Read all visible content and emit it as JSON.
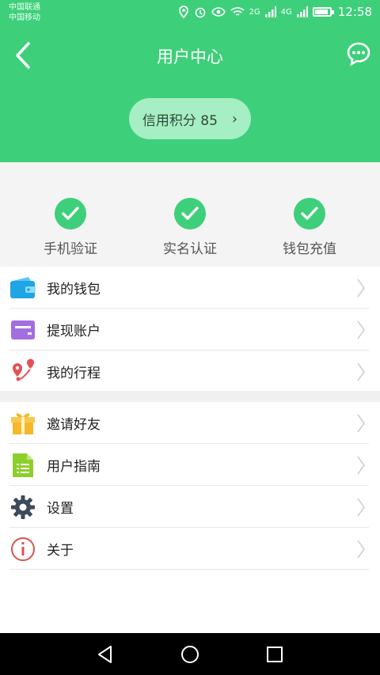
{
  "status_bar": {
    "carrier1": "中国联通",
    "carrier2": "中国移动",
    "net1": "2G",
    "net2": "4G",
    "time": "12:58",
    "battery_level_percent": 80
  },
  "header": {
    "title": "用户中心",
    "back_icon": "chevron-left-icon",
    "message_icon": "chat-bubble-icon"
  },
  "credit": {
    "label": "信用积分 85",
    "chevron": "›"
  },
  "verifications": [
    {
      "label": "手机验证",
      "status": "done"
    },
    {
      "label": "实名认证",
      "status": "done"
    },
    {
      "label": "钱包充值",
      "status": "done"
    }
  ],
  "menu_group1": [
    {
      "label": "我的钱包",
      "icon": "wallet-icon"
    },
    {
      "label": "提现账户",
      "icon": "card-icon"
    },
    {
      "label": "我的行程",
      "icon": "route-icon"
    }
  ],
  "menu_group2": [
    {
      "label": "邀请好友",
      "icon": "gift-icon"
    },
    {
      "label": "用户指南",
      "icon": "document-icon"
    },
    {
      "label": "设置",
      "icon": "gear-icon"
    },
    {
      "label": "关于",
      "icon": "info-icon"
    }
  ],
  "colors": {
    "primary": "#3ecf7a",
    "credit_pill": "#a6eec3"
  }
}
